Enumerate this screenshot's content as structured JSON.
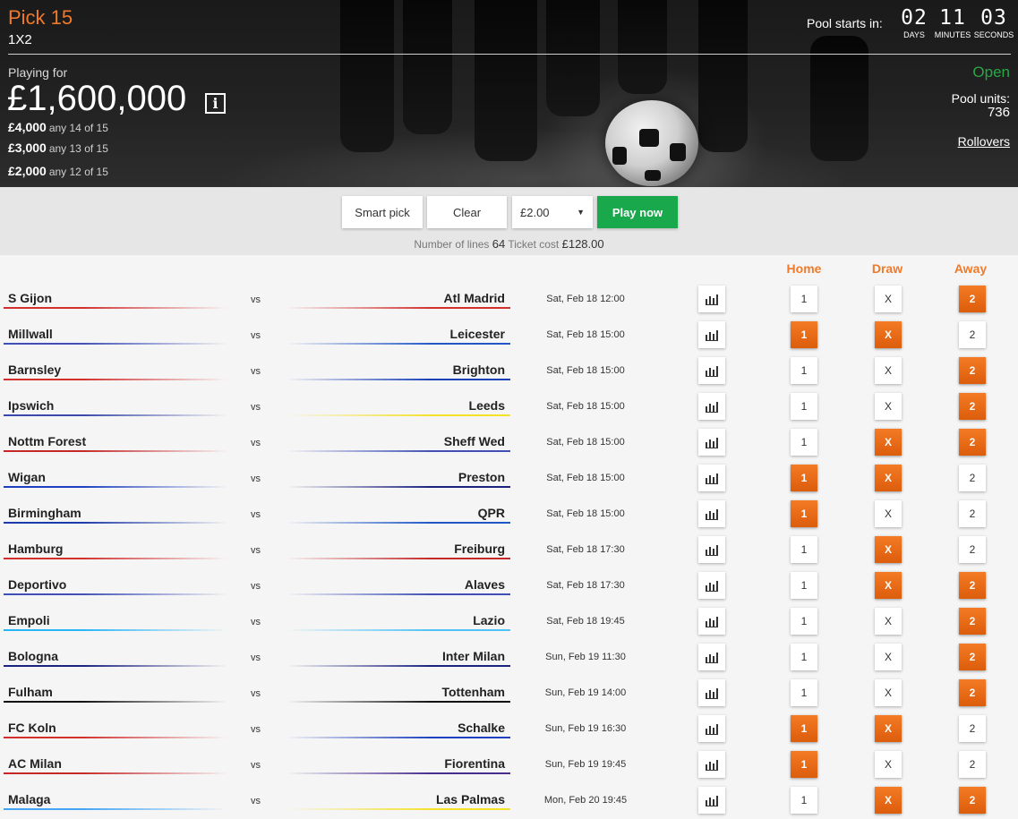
{
  "header": {
    "title": "Pick 15",
    "subtitle": "1X2",
    "pool_starts_label": "Pool starts in:",
    "countdown": [
      {
        "value": "02",
        "unit": "DAYS"
      },
      {
        "value": "11",
        "unit": "MINUTES"
      },
      {
        "value": "03",
        "unit": "SECONDS"
      }
    ],
    "playing_for_label": "Playing for",
    "jackpot": "£1,600,000",
    "info_glyph": "i",
    "prizes": [
      {
        "amount": "£4,000",
        "desc": "any 14 of 15"
      },
      {
        "amount": "£3,000",
        "desc": "any 13 of 15"
      },
      {
        "amount": "£2,000",
        "desc": "any 12 of 15"
      }
    ],
    "status": "Open",
    "status_color": "#28a745",
    "pool_units_label": "Pool units:",
    "pool_units_value": "736",
    "rollovers_label": "Rollovers"
  },
  "toolbar": {
    "smart_pick_label": "Smart pick",
    "clear_label": "Clear",
    "stake_value": "£2.00",
    "play_now_label": "Play now",
    "lines_label": "Number of lines",
    "lines_value": "64",
    "cost_label": "Ticket cost",
    "cost_value": "£128.00"
  },
  "columns": {
    "home": "Home",
    "draw": "Draw",
    "away": "Away"
  },
  "selection_labels": {
    "home": "1",
    "draw": "X",
    "away": "2"
  },
  "accent_color": "#f07a2a",
  "matches": [
    {
      "home": "S Gijon",
      "away": "Atl Madrid",
      "date": "Sat, Feb 18 12:00",
      "home_color": "#d32f2f",
      "away_color": "#d32f2f",
      "sel": [
        false,
        false,
        true
      ]
    },
    {
      "home": "Millwall",
      "away": "Leicester",
      "date": "Sat, Feb 18 15:00",
      "home_color": "#3f51b5",
      "away_color": "#2457c5",
      "sel": [
        true,
        true,
        false
      ]
    },
    {
      "home": "Barnsley",
      "away": "Brighton",
      "date": "Sat, Feb 18 15:00",
      "home_color": "#d32f2f",
      "away_color": "#1a3fb8",
      "sel": [
        false,
        false,
        true
      ]
    },
    {
      "home": "Ipswich",
      "away": "Leeds",
      "date": "Sat, Feb 18 15:00",
      "home_color": "#3949ab",
      "away_color": "#f4e12a",
      "sel": [
        false,
        false,
        true
      ]
    },
    {
      "home": "Nottm Forest",
      "away": "Sheff Wed",
      "date": "Sat, Feb 18 15:00",
      "home_color": "#c62828",
      "away_color": "#3f51b5",
      "sel": [
        false,
        true,
        true
      ]
    },
    {
      "home": "Wigan",
      "away": "Preston",
      "date": "Sat, Feb 18 15:00",
      "home_color": "#1e40c0",
      "away_color": "#1a237e",
      "sel": [
        true,
        true,
        false
      ]
    },
    {
      "home": "Birmingham",
      "away": "QPR",
      "date": "Sat, Feb 18 15:00",
      "home_color": "#1e3aa8",
      "away_color": "#1e56c5",
      "sel": [
        true,
        false,
        false
      ]
    },
    {
      "home": "Hamburg",
      "away": "Freiburg",
      "date": "Sat, Feb 18 17:30",
      "home_color": "#d32f2f",
      "away_color": "#c62828",
      "sel": [
        false,
        true,
        false
      ]
    },
    {
      "home": "Deportivo",
      "away": "Alaves",
      "date": "Sat, Feb 18 17:30",
      "home_color": "#3f51b5",
      "away_color": "#3f51b5",
      "sel": [
        false,
        true,
        true
      ]
    },
    {
      "home": "Empoli",
      "away": "Lazio",
      "date": "Sat, Feb 18 19:45",
      "home_color": "#29b6f6",
      "away_color": "#4fc3f7",
      "sel": [
        false,
        false,
        true
      ]
    },
    {
      "home": "Bologna",
      "away": "Inter Milan",
      "date": "Sun, Feb 19 11:30",
      "home_color": "#1a237e",
      "away_color": "#1a237e",
      "sel": [
        false,
        false,
        true
      ]
    },
    {
      "home": "Fulham",
      "away": "Tottenham",
      "date": "Sun, Feb 19 14:00",
      "home_color": "#111111",
      "away_color": "#111111",
      "sel": [
        false,
        false,
        true
      ]
    },
    {
      "home": "FC Koln",
      "away": "Schalke",
      "date": "Sun, Feb 19 16:30",
      "home_color": "#d32f2f",
      "away_color": "#1e40c0",
      "sel": [
        true,
        true,
        false
      ]
    },
    {
      "home": "AC Milan",
      "away": "Fiorentina",
      "date": "Sun, Feb 19 19:45",
      "home_color": "#c62828",
      "away_color": "#4a2c8f",
      "sel": [
        true,
        false,
        false
      ]
    },
    {
      "home": "Malaga",
      "away": "Las Palmas",
      "date": "Mon, Feb 20 19:45",
      "home_color": "#42a5f5",
      "away_color": "#f4e12a",
      "sel": [
        false,
        true,
        true
      ]
    }
  ]
}
